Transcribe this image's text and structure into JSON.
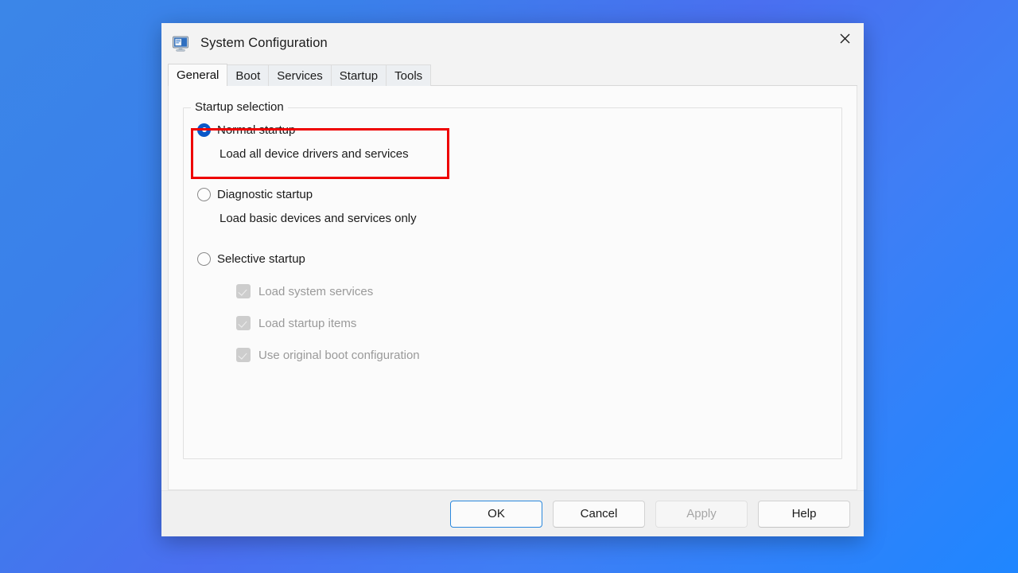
{
  "window": {
    "title": "System Configuration",
    "icon": "system-configuration-monitor-icon",
    "close_label": "✕"
  },
  "tabs": [
    {
      "label": "General",
      "active": true
    },
    {
      "label": "Boot",
      "active": false
    },
    {
      "label": "Services",
      "active": false
    },
    {
      "label": "Startup",
      "active": false
    },
    {
      "label": "Tools",
      "active": false
    }
  ],
  "groupbox": {
    "legend": "Startup selection"
  },
  "options": {
    "normal": {
      "label": "Normal startup",
      "description": "Load all device drivers and services",
      "selected": true
    },
    "diagnostic": {
      "label": "Diagnostic startup",
      "description": "Load basic devices and services only",
      "selected": false
    },
    "selective": {
      "label": "Selective startup",
      "selected": false,
      "checkboxes": [
        {
          "label": "Load system services",
          "checked": true,
          "disabled": true
        },
        {
          "label": "Load startup items",
          "checked": true,
          "disabled": true
        },
        {
          "label": "Use original boot configuration",
          "checked": true,
          "disabled": true
        }
      ]
    }
  },
  "highlight": {
    "color": "#ee0000",
    "target": "normal-startup-option"
  },
  "footer": {
    "buttons": [
      {
        "label": "OK",
        "state": "default"
      },
      {
        "label": "Cancel",
        "state": "normal"
      },
      {
        "label": "Apply",
        "state": "disabled"
      },
      {
        "label": "Help",
        "state": "normal"
      }
    ]
  },
  "colors": {
    "accent": "#0a58c8",
    "desktop_blue": "#3b86e8",
    "highlight_red": "#ee0000",
    "default_button_border": "#2b88dd"
  }
}
